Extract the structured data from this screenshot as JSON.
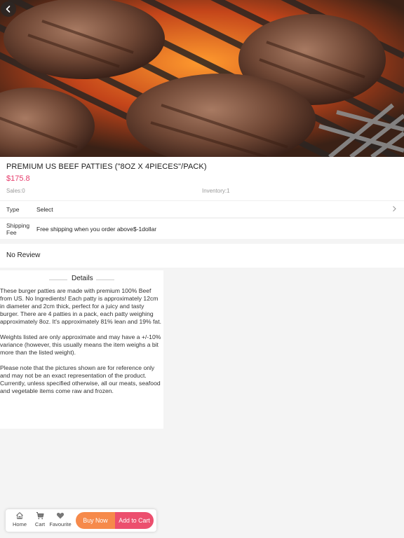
{
  "product": {
    "title": "PREMIUM US BEEF PATTIES (\"8OZ X 4PIECES\"/PACK)",
    "price": "$175.8",
    "sales": "Sales:0",
    "inventory": "Inventory:1"
  },
  "options": {
    "type_label": "Type",
    "type_value": "Select",
    "shipping_label": "Shipping Fee",
    "shipping_value": "Free shipping when you order above$-1dollar"
  },
  "review": {
    "text": "No Review"
  },
  "details": {
    "heading": "Details",
    "paragraphs": [
      "These burger patties are made with premium 100% Beef from US. No Ingredients! Each patty is approximately 12cm in diameter and 2cm thick, perfect for a juicy and tasty burger. There are 4 patties in a pack, each patty weighing approximately 8oz. It's approximately 81% lean and 19% fat.",
      "Weights listed are only approximate and may have a +/-10% variance (however, this usually means the item weighs a bit more than the listed weight).",
      "Please note that the pictures shown are for reference only and may not be an exact representation of the product. Currently, unless specified otherwise, all our meats, seafood and vegetable items come raw and frozen."
    ]
  },
  "bottom_bar": {
    "home": "Home",
    "cart": "Cart",
    "favourite": "Favourite",
    "buy_now": "Buy Now",
    "add_to_cart": "Add to Cart"
  },
  "colors": {
    "price": "#e63b6b",
    "buy_now": "#f68a4b",
    "add_to_cart": "#ec4f6e"
  },
  "icons": {
    "back": "chevron-left-icon",
    "type_row": "chevron-right-icon",
    "home": "home-icon",
    "cart": "cart-icon",
    "favourite": "heart-icon"
  }
}
